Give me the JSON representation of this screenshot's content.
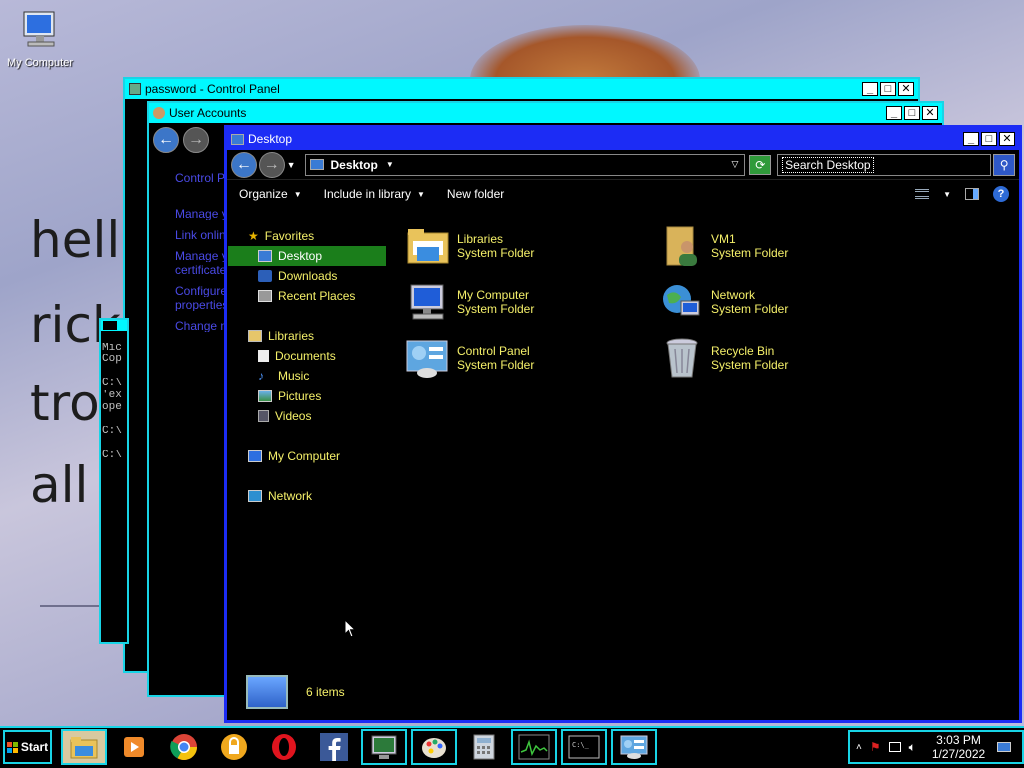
{
  "wallpaper": {
    "text_lines": [
      "hell",
      "rick",
      "tro",
      "all"
    ]
  },
  "desktop_icons": [
    {
      "label": "My Computer"
    }
  ],
  "windows": {
    "control_panel": {
      "title": "password - Control Panel"
    },
    "user_accounts": {
      "title": "User Accounts",
      "links": [
        "Control Pa",
        "Manage y",
        "Link onlin",
        "Manage y",
        "certificate",
        "Configure",
        "properties",
        "Change m"
      ]
    },
    "cmd": {
      "lines": [
        "Mic",
        "Cop",
        "",
        "C:\\",
        "'ex",
        "ope",
        "",
        "C:\\",
        "",
        "C:\\"
      ]
    },
    "explorer": {
      "title": "Desktop",
      "address": "Desktop",
      "search_placeholder": "Search Desktop",
      "toolbar": {
        "organize": "Organize",
        "include": "Include in library",
        "new_folder": "New folder"
      },
      "nav": {
        "favorites": "Favorites",
        "desktop": "Desktop",
        "downloads": "Downloads",
        "recent": "Recent Places",
        "libraries": "Libraries",
        "documents": "Documents",
        "music": "Music",
        "pictures": "Pictures",
        "videos": "Videos",
        "computer": "My Computer",
        "network": "Network"
      },
      "items": [
        {
          "name": "Libraries",
          "type": "System Folder",
          "icon": "libraries-icon"
        },
        {
          "name": "VM1",
          "type": "System Folder",
          "icon": "user-folder-icon"
        },
        {
          "name": "My Computer",
          "type": "System Folder",
          "icon": "computer-icon"
        },
        {
          "name": "Network",
          "type": "System Folder",
          "icon": "network-icon"
        },
        {
          "name": "Control Panel",
          "type": "System Folder",
          "icon": "control-panel-icon"
        },
        {
          "name": "Recycle Bin",
          "type": "System Folder",
          "icon": "recycle-bin-icon"
        }
      ],
      "status": "6 items"
    }
  },
  "taskbar": {
    "start": "Start",
    "apps": [
      "file-explorer",
      "media-player",
      "chrome",
      "security",
      "opera",
      "facebook",
      "computer-manager",
      "paint",
      "calculator",
      "resource-monitor",
      "command-prompt",
      "control-panel"
    ],
    "clock_time": "3:03 PM",
    "clock_date": "1/27/2022"
  },
  "colors": {
    "accent": "#18d4e6",
    "title_blue": "#1c2cf5",
    "text_yellow": "#f5f06a",
    "selected_green": "#1b7e1b"
  }
}
